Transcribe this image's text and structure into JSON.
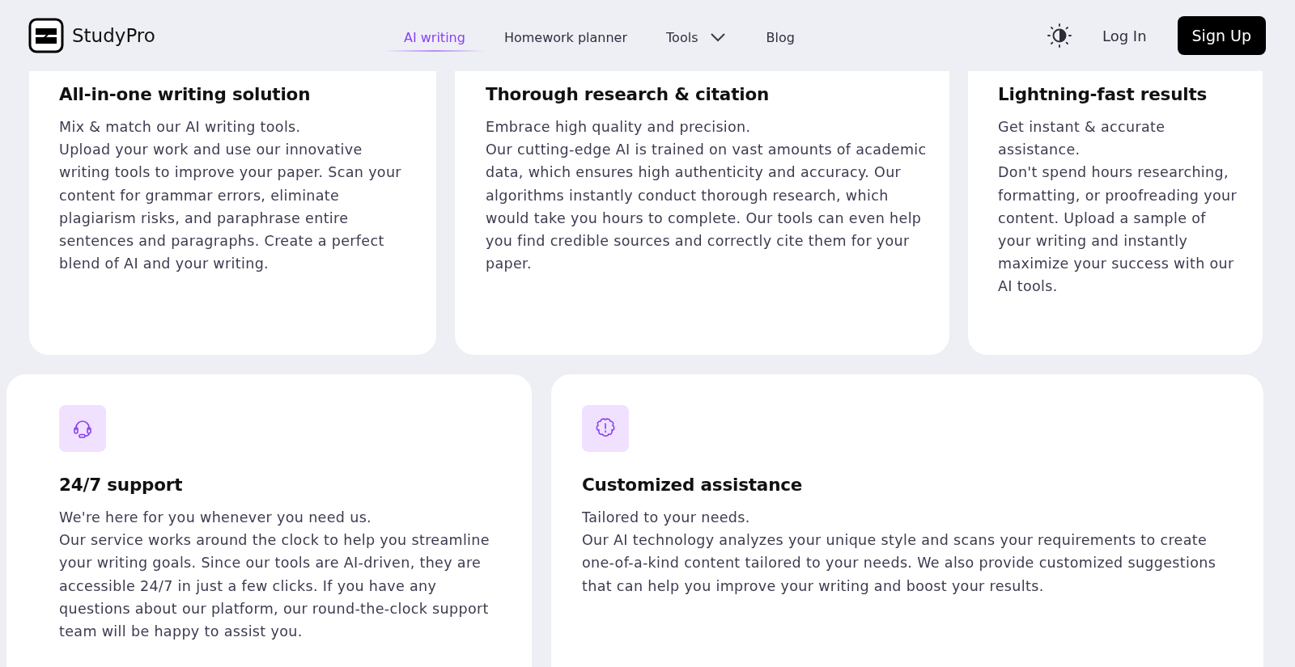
{
  "header": {
    "brand": "StudyPro",
    "nav": [
      {
        "label": "AI writing",
        "selected": true,
        "kind": "link"
      },
      {
        "label": "Homework planner",
        "selected": false,
        "kind": "link"
      },
      {
        "label": "Tools",
        "selected": false,
        "kind": "dropdown"
      },
      {
        "label": "Blog",
        "selected": false,
        "kind": "link"
      }
    ],
    "login": "Log In",
    "signup": "Sign Up"
  },
  "features_top": [
    {
      "title": "All-in-one writing solution",
      "lead": "Mix & match our AI writing tools.",
      "body": "Upload your work and use our innovative writing tools to improve your paper. Scan your content for grammar errors, eliminate plagiarism risks, and paraphrase entire sentences and paragraphs. Create a perfect blend of AI and your writing."
    },
    {
      "title": "Thorough research & citation",
      "lead": "Embrace high quality and precision.",
      "body": "Our cutting-edge AI is trained on vast amounts of academic data, which ensures high authenticity and accuracy. Our algorithms instantly conduct thorough research, which would take you hours to complete. Our tools can even help you find credible sources and correctly cite them for your paper."
    },
    {
      "title": "Lightning-fast results",
      "lead": "Get instant & accurate assistance.",
      "body": "Don't spend hours researching, formatting, or proofreading your content. Upload a sample of your writing and instantly maximize your success with our AI tools."
    }
  ],
  "features_bottom": [
    {
      "kind": "headset",
      "title": "24/7 support",
      "lead": "We're here for you whenever you need us.",
      "body": "Our service works around the clock to help you streamline your writing goals. Since our tools are AI-driven, they are accessible 24/7 in just a few clicks. If you have any questions about our platform, our round-the-clock support team will be happy to assist you."
    },
    {
      "kind": "brain",
      "title": "Customized assistance",
      "lead": "Tailored to your needs.",
      "body": "Our AI technology analyzes your unique style and scans your requirements to create one-of-a-kind content tailored to your needs. We also provide customized suggestions that can help you improve your writing and boost your results."
    }
  ]
}
